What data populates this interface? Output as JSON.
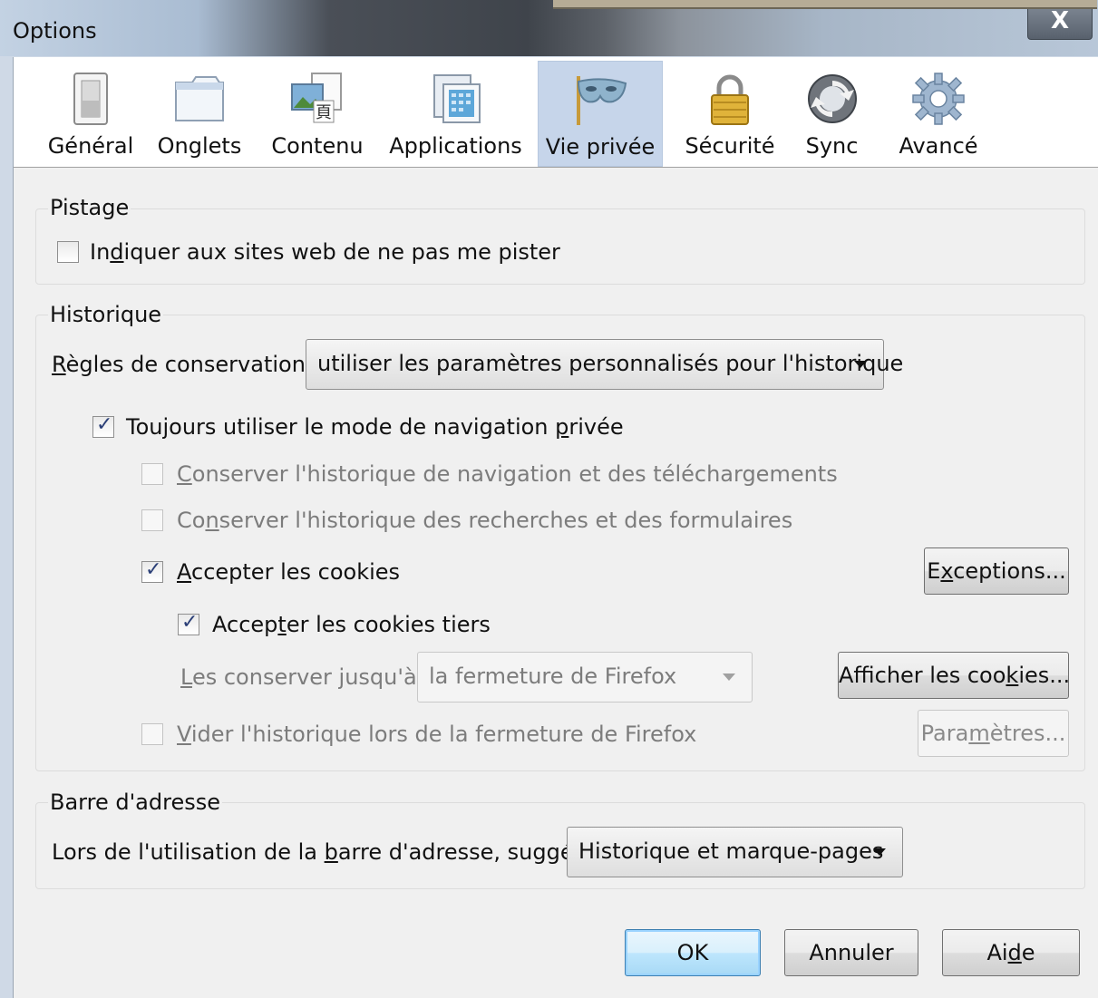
{
  "window": {
    "title": "Options",
    "close_label": "X"
  },
  "tabs": [
    {
      "label": "Général",
      "icon": "general-switch-icon"
    },
    {
      "label": "Onglets",
      "icon": "tabs-icon"
    },
    {
      "label": "Contenu",
      "icon": "content-icon"
    },
    {
      "label": "Applications",
      "icon": "applications-icon"
    },
    {
      "label": "Vie privée",
      "icon": "privacy-mask-icon",
      "selected": true
    },
    {
      "label": "Sécurité",
      "icon": "security-lock-icon"
    },
    {
      "label": "Sync",
      "icon": "sync-icon"
    },
    {
      "label": "Avancé",
      "icon": "advanced-gear-icon"
    }
  ],
  "tracking": {
    "legend": "Pistage",
    "dnt": {
      "pre": "In",
      "key": "d",
      "post": "iquer aux sites web de ne pas me pister",
      "checked": false
    }
  },
  "history": {
    "legend": "Historique",
    "rules_label": {
      "pre": "",
      "key": "R",
      "post": "ègles de conservation :"
    },
    "rules_value": "utiliser les paramètres personnalisés pour l'historique",
    "private_mode": {
      "pre": "Toujours utiliser le mode de navigation ",
      "key": "p",
      "post": "rivée",
      "checked": true
    },
    "keep_nav": {
      "pre": "",
      "key": "C",
      "post": "onserver l'historique de navigation et des téléchargements",
      "checked": false,
      "disabled": true
    },
    "keep_search": {
      "pre": "Co",
      "key": "n",
      "post": "server l'historique des recherches et des formulaires",
      "checked": false,
      "disabled": true
    },
    "accept_cookies": {
      "pre": "",
      "key": "A",
      "post": "ccepter les cookies",
      "checked": true
    },
    "exceptions_btn": {
      "pre": "E",
      "key": "x",
      "post": "ceptions..."
    },
    "third_party": {
      "pre": "Accep",
      "key": "t",
      "post": "er les cookies tiers",
      "checked": true
    },
    "keep_until_label": {
      "pre": "",
      "key": "L",
      "post": "es conserver jusqu'à :"
    },
    "keep_until_value": "la fermeture de Firefox",
    "show_cookies_btn": {
      "pre": "Afficher les coo",
      "key": "k",
      "post": "ies..."
    },
    "clear_on_close": {
      "pre": "",
      "key": "V",
      "post": "ider l'historique lors de la fermeture de Firefox",
      "checked": false,
      "disabled": true
    },
    "settings_btn": {
      "pre": "Para",
      "key": "m",
      "post": "ètres..."
    }
  },
  "address_bar": {
    "legend": "Barre d'adresse",
    "label": {
      "pre": "Lors de l'utilisation de la ",
      "key": "b",
      "post": "arre d'adresse, suggérer :"
    },
    "value": "Historique et marque-pages"
  },
  "footer": {
    "ok": "OK",
    "cancel": "Annuler",
    "help": {
      "pre": "Ai",
      "key": "d",
      "post": "e"
    }
  }
}
